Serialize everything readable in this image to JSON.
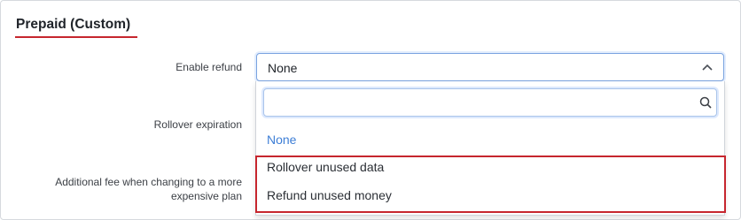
{
  "section": {
    "title": "Prepaid (Custom)"
  },
  "fields": {
    "enable_refund_label": "Enable refund",
    "rollover_expiration_label": "Rollover expiration",
    "additional_fee_label": "Additional fee when changing to a more expensive plan"
  },
  "select": {
    "value": "None",
    "search_placeholder": "",
    "options": [
      "None",
      "Rollover unused data",
      "Refund unused money"
    ]
  },
  "icons": {
    "chevron": "chevron-up-icon",
    "search": "search-icon"
  },
  "colors": {
    "accent_red": "#c6262e",
    "selected_blue": "#3d7ed6",
    "focus_blue": "#7aa3e0"
  }
}
